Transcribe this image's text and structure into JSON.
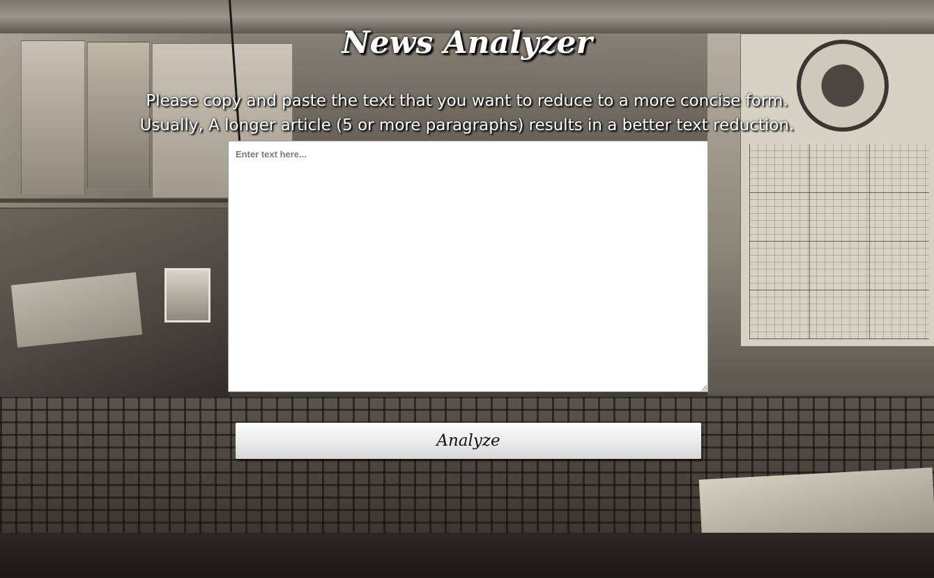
{
  "app": {
    "title": "News Analyzer"
  },
  "instructions": {
    "line1": "Please copy and paste the text that you want to reduce to a more concise form.",
    "line2": "Usually, A longer article (5 or more paragraphs) results in a better text reduction."
  },
  "input": {
    "value": "",
    "placeholder": "Enter text here..."
  },
  "actions": {
    "analyze_label": "Analyze"
  },
  "colors": {
    "title_text": "#ffffff",
    "button_bg": "#e6e6e6",
    "input_bg": "#ffffff"
  }
}
